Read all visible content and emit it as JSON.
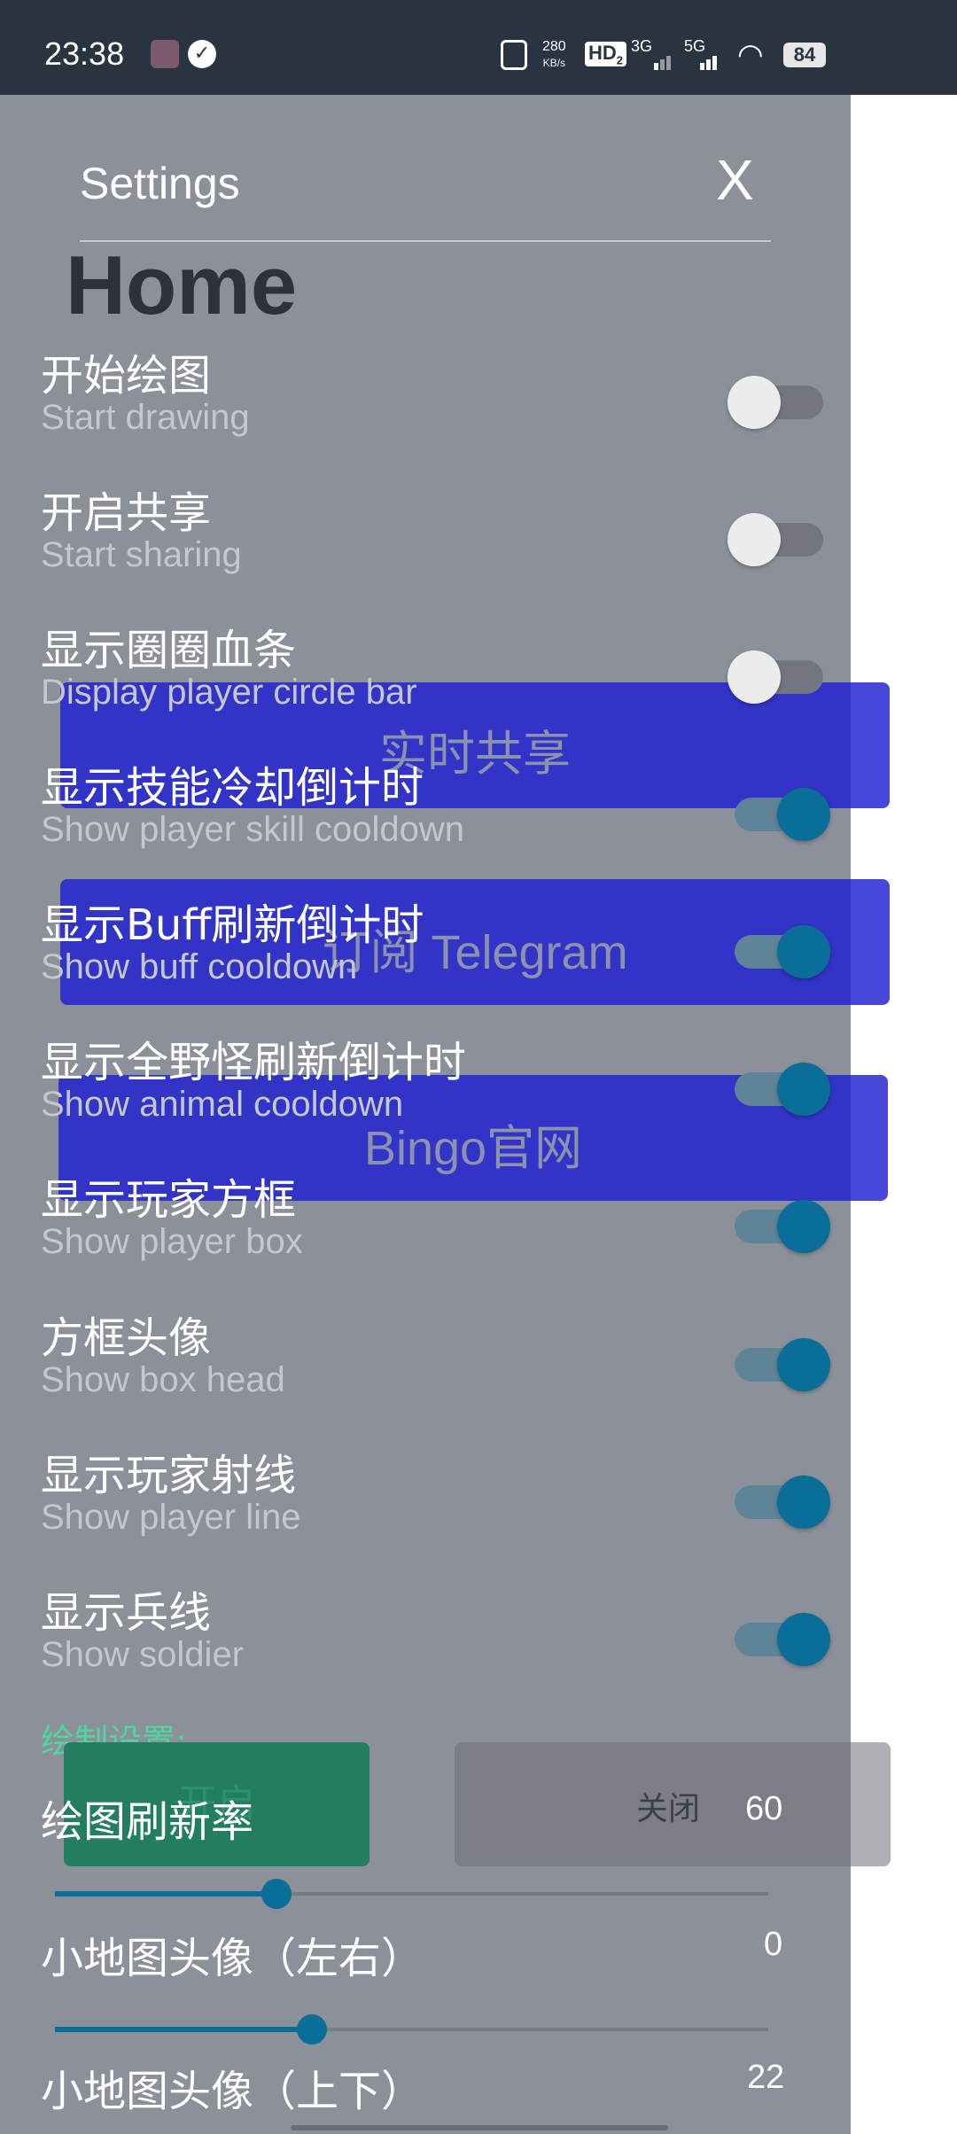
{
  "status_bar": {
    "time": "23:38",
    "net_speed_value": "280",
    "net_speed_unit": "KB/s",
    "hd_label": "HD",
    "hd_sub": "2",
    "sim1": "3G",
    "sim2": "5G",
    "battery": "84"
  },
  "panel": {
    "title": "Settings",
    "close_label": "X",
    "section_heading": "Home"
  },
  "settings": [
    {
      "cn": "开始绘图",
      "en": "Start drawing",
      "on": false
    },
    {
      "cn": "开启共享",
      "en": "Start sharing",
      "on": false
    },
    {
      "cn": "显示圈圈血条",
      "en": "Display player circle bar",
      "on": false
    },
    {
      "cn": "显示技能冷却倒计时",
      "en": "Show player skill cooldown",
      "on": true
    },
    {
      "cn": "显示Buff刷新倒计时",
      "en": "Show buff cooldown",
      "on": true
    },
    {
      "cn": "显示全野怪刷新倒计时",
      "en": "Show animal cooldown",
      "on": true
    },
    {
      "cn": "显示玩家方框",
      "en": "Show player box",
      "on": true
    },
    {
      "cn": "方框头像",
      "en": "Show box head",
      "on": true
    },
    {
      "cn": "显示玩家射线",
      "en": "Show player line",
      "on": true
    },
    {
      "cn": "显示兵线",
      "en": "Show soldier",
      "on": true
    }
  ],
  "overlay_buttons": {
    "share": "实时共享",
    "telegram": "订阅 Telegram",
    "official": "Bingo官网"
  },
  "draw_settings": {
    "label": "绘制设置:",
    "open_button": "开启",
    "close_button": "关闭"
  },
  "sliders": [
    {
      "label": "绘图刷新率",
      "value": "60",
      "fraction": 0.31
    },
    {
      "label": "小地图头像（左右）",
      "value": "0",
      "fraction": 0.36
    },
    {
      "label": "小地图头像（上下）",
      "value": "22",
      "fraction": null
    }
  ]
}
